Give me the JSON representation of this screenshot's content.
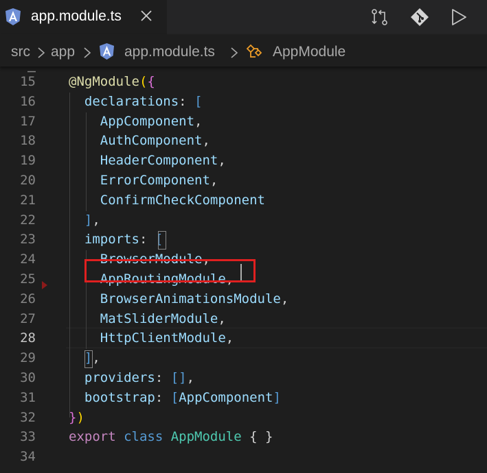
{
  "tab": {
    "icon": "angular-icon",
    "label": "app.module.ts",
    "close_icon": "close-icon"
  },
  "actions": [
    {
      "name": "compare-changes-icon"
    },
    {
      "name": "git-icon"
    },
    {
      "name": "run-icon"
    }
  ],
  "breadcrumb": {
    "items": [
      "src",
      "app",
      "app.module.ts",
      "AppModule"
    ],
    "separator_icon": "chevron-right-icon",
    "file_icon": "angular-icon",
    "symbol_icon": "class-symbol-icon"
  },
  "editor": {
    "line_numbers": [
      "15",
      "16",
      "17",
      "18",
      "19",
      "20",
      "21",
      "22",
      "23",
      "24",
      "25",
      "26",
      "27",
      "28",
      "29",
      "30",
      "31",
      "32",
      "33",
      "34"
    ],
    "current_line": "28",
    "lines": [
      [
        {
          "t": "@NgModule",
          "c": "dec"
        },
        {
          "t": "(",
          "c": "y"
        },
        {
          "t": "{",
          "c": "m"
        }
      ],
      [
        {
          "t": "  "
        },
        {
          "t": "declarations",
          "c": "prop"
        },
        {
          "t": ": ",
          "c": "pun"
        },
        {
          "t": "[",
          "c": "kw"
        }
      ],
      [
        {
          "t": "    "
        },
        {
          "t": "AppComponent",
          "c": "prop"
        },
        {
          "t": ",",
          "c": "pun"
        }
      ],
      [
        {
          "t": "    "
        },
        {
          "t": "AuthComponent",
          "c": "prop"
        },
        {
          "t": ",",
          "c": "pun"
        }
      ],
      [
        {
          "t": "    "
        },
        {
          "t": "HeaderComponent",
          "c": "prop"
        },
        {
          "t": ",",
          "c": "pun"
        }
      ],
      [
        {
          "t": "    "
        },
        {
          "t": "ErrorComponent",
          "c": "prop"
        },
        {
          "t": ",",
          "c": "pun"
        }
      ],
      [
        {
          "t": "    "
        },
        {
          "t": "ConfirmCheckComponent",
          "c": "prop"
        }
      ],
      [
        {
          "t": "  "
        },
        {
          "t": "]",
          "c": "kw"
        },
        {
          "t": ",",
          "c": "pun"
        }
      ],
      [
        {
          "t": "  "
        },
        {
          "t": "imports",
          "c": "prop"
        },
        {
          "t": ": ",
          "c": "pun"
        },
        {
          "t": "[",
          "c": "kw"
        }
      ],
      [
        {
          "t": "    "
        },
        {
          "t": "BrowserModule",
          "c": "prop"
        },
        {
          "t": ",",
          "c": "pun"
        }
      ],
      [
        {
          "t": "    "
        },
        {
          "t": "AppRoutingModule",
          "c": "prop"
        },
        {
          "t": ",",
          "c": "pun"
        }
      ],
      [
        {
          "t": "    "
        },
        {
          "t": "BrowserAnimationsModule",
          "c": "prop"
        },
        {
          "t": ",",
          "c": "pun"
        }
      ],
      [
        {
          "t": "    "
        },
        {
          "t": "MatSliderModule",
          "c": "prop"
        },
        {
          "t": ",",
          "c": "pun"
        }
      ],
      [
        {
          "t": "    "
        },
        {
          "t": "HttpClientModule",
          "c": "prop"
        },
        {
          "t": ",",
          "c": "pun"
        }
      ],
      [
        {
          "t": "  "
        },
        {
          "t": "]",
          "c": "kw"
        },
        {
          "t": ",",
          "c": "pun"
        }
      ],
      [
        {
          "t": "  "
        },
        {
          "t": "providers",
          "c": "prop"
        },
        {
          "t": ": ",
          "c": "pun"
        },
        {
          "t": "[]",
          "c": "kw"
        },
        {
          "t": ",",
          "c": "pun"
        }
      ],
      [
        {
          "t": "  "
        },
        {
          "t": "bootstrap",
          "c": "prop"
        },
        {
          "t": ": ",
          "c": "pun"
        },
        {
          "t": "[",
          "c": "kw"
        },
        {
          "t": "AppComponent",
          "c": "prop"
        },
        {
          "t": "]",
          "c": "kw"
        }
      ],
      [
        {
          "t": "}",
          "c": "m"
        },
        {
          "t": ")",
          "c": "y"
        }
      ],
      [
        {
          "t": "export ",
          "c": "kwp"
        },
        {
          "t": "class ",
          "c": "kw"
        },
        {
          "t": "AppModule",
          "c": "type"
        },
        {
          "t": " { }",
          "c": "pun"
        }
      ],
      []
    ]
  },
  "colors": {
    "background": "#1e1e1e",
    "tabbar": "#252526",
    "highlight_box": "#e02020"
  }
}
